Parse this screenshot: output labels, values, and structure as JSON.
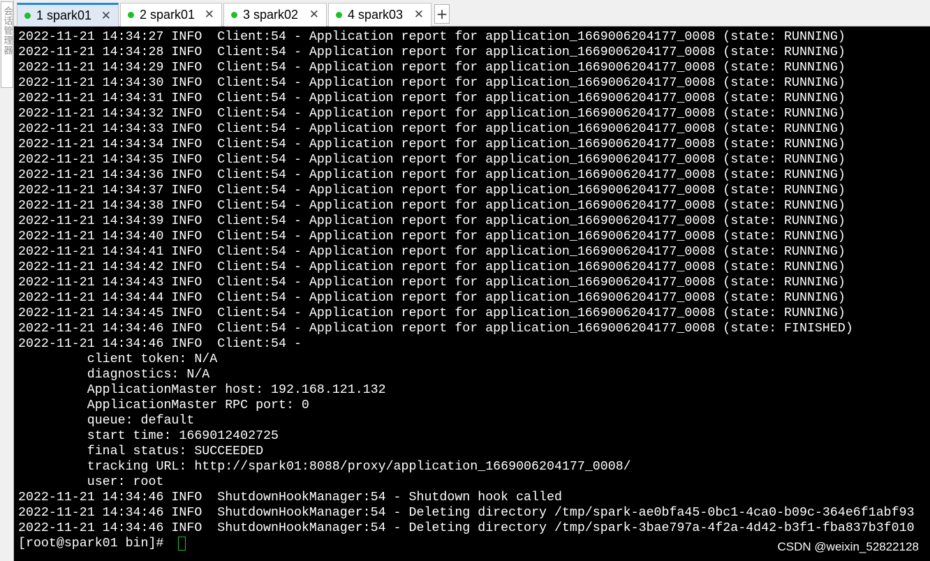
{
  "side_panel": {
    "label": "会话管理器"
  },
  "tabs": [
    {
      "label": "1 spark01",
      "active": true,
      "close": "✕"
    },
    {
      "label": "2 spark01",
      "active": false,
      "close": "✕"
    },
    {
      "label": "3 spark02",
      "active": false,
      "close": "✕"
    },
    {
      "label": "4 spark03",
      "active": false,
      "close": "✕"
    }
  ],
  "new_tab_label": "+",
  "colors": {
    "accent": "#1e88e5",
    "status_dot": "#1fbf2a",
    "cursor": "#1fbf2a",
    "terminal_bg": "#000000"
  },
  "terminal": {
    "lines": [
      "2022-11-21 14:34:27 INFO  Client:54 - Application report for application_1669006204177_0008 (state: RUNNING)",
      "2022-11-21 14:34:28 INFO  Client:54 - Application report for application_1669006204177_0008 (state: RUNNING)",
      "2022-11-21 14:34:29 INFO  Client:54 - Application report for application_1669006204177_0008 (state: RUNNING)",
      "2022-11-21 14:34:30 INFO  Client:54 - Application report for application_1669006204177_0008 (state: RUNNING)",
      "2022-11-21 14:34:31 INFO  Client:54 - Application report for application_1669006204177_0008 (state: RUNNING)",
      "2022-11-21 14:34:32 INFO  Client:54 - Application report for application_1669006204177_0008 (state: RUNNING)",
      "2022-11-21 14:34:33 INFO  Client:54 - Application report for application_1669006204177_0008 (state: RUNNING)",
      "2022-11-21 14:34:34 INFO  Client:54 - Application report for application_1669006204177_0008 (state: RUNNING)",
      "2022-11-21 14:34:35 INFO  Client:54 - Application report for application_1669006204177_0008 (state: RUNNING)",
      "2022-11-21 14:34:36 INFO  Client:54 - Application report for application_1669006204177_0008 (state: RUNNING)",
      "2022-11-21 14:34:37 INFO  Client:54 - Application report for application_1669006204177_0008 (state: RUNNING)",
      "2022-11-21 14:34:38 INFO  Client:54 - Application report for application_1669006204177_0008 (state: RUNNING)",
      "2022-11-21 14:34:39 INFO  Client:54 - Application report for application_1669006204177_0008 (state: RUNNING)",
      "2022-11-21 14:34:40 INFO  Client:54 - Application report for application_1669006204177_0008 (state: RUNNING)",
      "2022-11-21 14:34:41 INFO  Client:54 - Application report for application_1669006204177_0008 (state: RUNNING)",
      "2022-11-21 14:34:42 INFO  Client:54 - Application report for application_1669006204177_0008 (state: RUNNING)",
      "2022-11-21 14:34:43 INFO  Client:54 - Application report for application_1669006204177_0008 (state: RUNNING)",
      "2022-11-21 14:34:44 INFO  Client:54 - Application report for application_1669006204177_0008 (state: RUNNING)",
      "2022-11-21 14:34:45 INFO  Client:54 - Application report for application_1669006204177_0008 (state: RUNNING)",
      "2022-11-21 14:34:46 INFO  Client:54 - Application report for application_1669006204177_0008 (state: FINISHED)",
      "2022-11-21 14:34:46 INFO  Client:54 - ",
      "         client token: N/A",
      "         diagnostics: N/A",
      "         ApplicationMaster host: 192.168.121.132",
      "         ApplicationMaster RPC port: 0",
      "         queue: default",
      "         start time: 1669012402725",
      "         final status: SUCCEEDED",
      "         tracking URL: http://spark01:8088/proxy/application_1669006204177_0008/",
      "         user: root",
      "2022-11-21 14:34:46 INFO  ShutdownHookManager:54 - Shutdown hook called",
      "2022-11-21 14:34:46 INFO  ShutdownHookManager:54 - Deleting directory /tmp/spark-ae0bfa45-0bc1-4ca0-b09c-364e6f1abf93",
      "2022-11-21 14:34:46 INFO  ShutdownHookManager:54 - Deleting directory /tmp/spark-3bae797a-4f2a-4d42-b3f1-fba837b3f010"
    ],
    "prompt": "[root@spark01 bin]# "
  },
  "watermark": "CSDN @weixin_52822128"
}
